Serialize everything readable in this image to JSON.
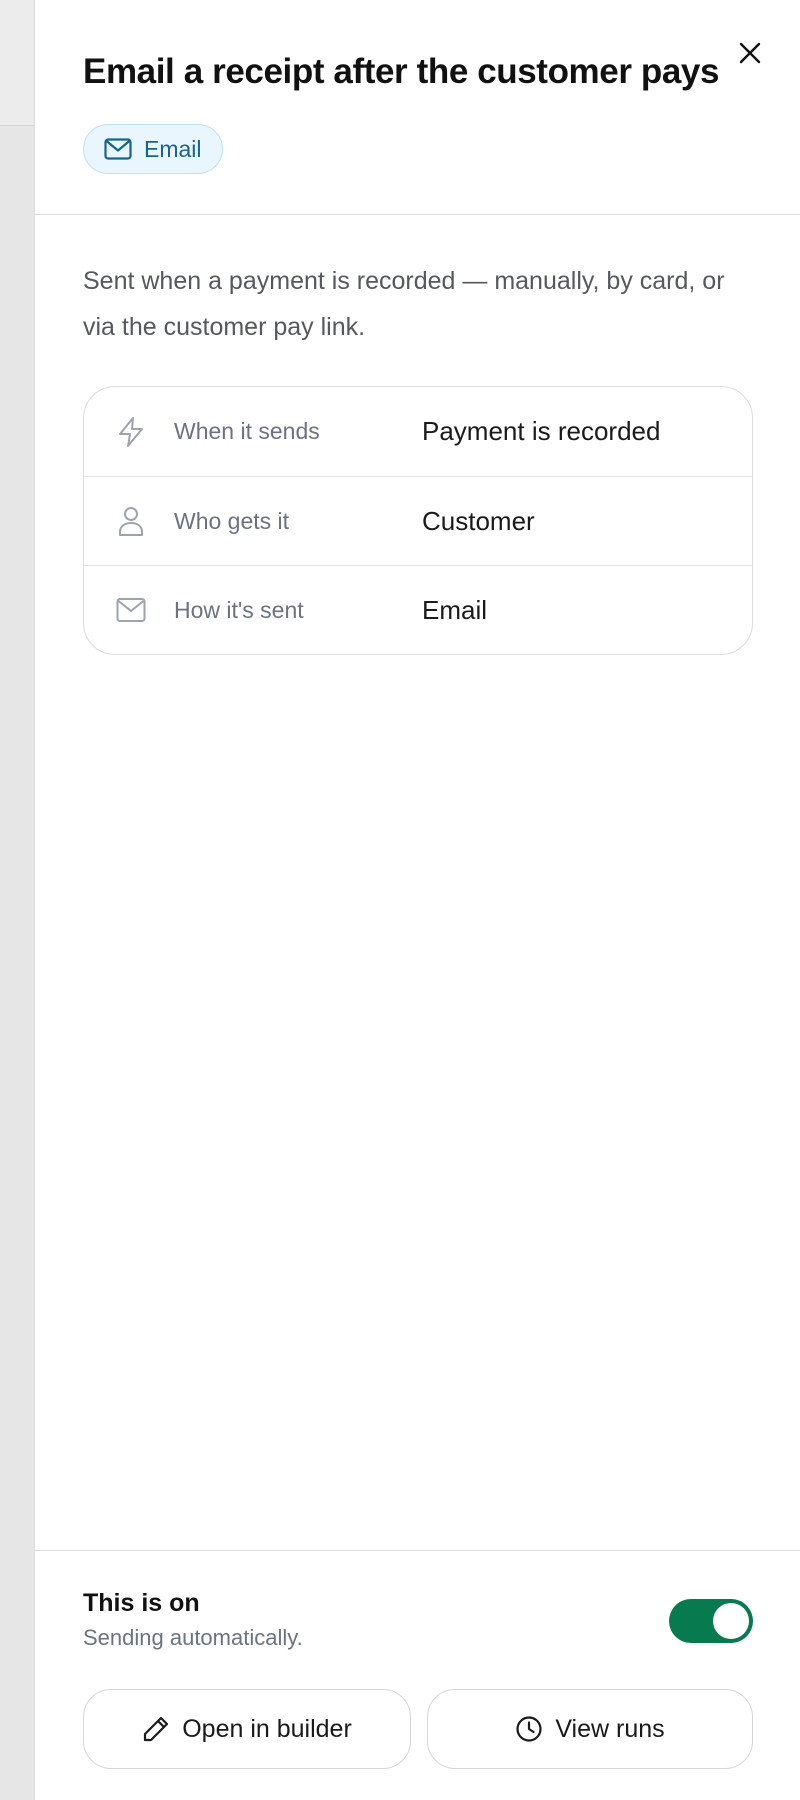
{
  "panel": {
    "title": "Email a receipt after the customer pays",
    "channel_chip": {
      "label": "Email",
      "icon": "mail-icon"
    },
    "description": "Sent when a payment is recorded — manually, by card, or via the customer pay link."
  },
  "details": [
    {
      "icon": "lightning-icon",
      "label": "When it sends",
      "value": "Payment is recorded"
    },
    {
      "icon": "person-icon",
      "label": "Who gets it",
      "value": "Customer"
    },
    {
      "icon": "mail-icon",
      "label": "How it's sent",
      "value": "Email"
    }
  ],
  "footer": {
    "status_title": "This is on",
    "status_subtitle": "Sending automatically.",
    "toggle_on": true,
    "open_builder_label": "Open in builder",
    "view_runs_label": "View runs"
  },
  "colors": {
    "toggle_on": "#087a4f",
    "chip_bg": "#eaf6fd",
    "chip_text": "#14648e"
  }
}
